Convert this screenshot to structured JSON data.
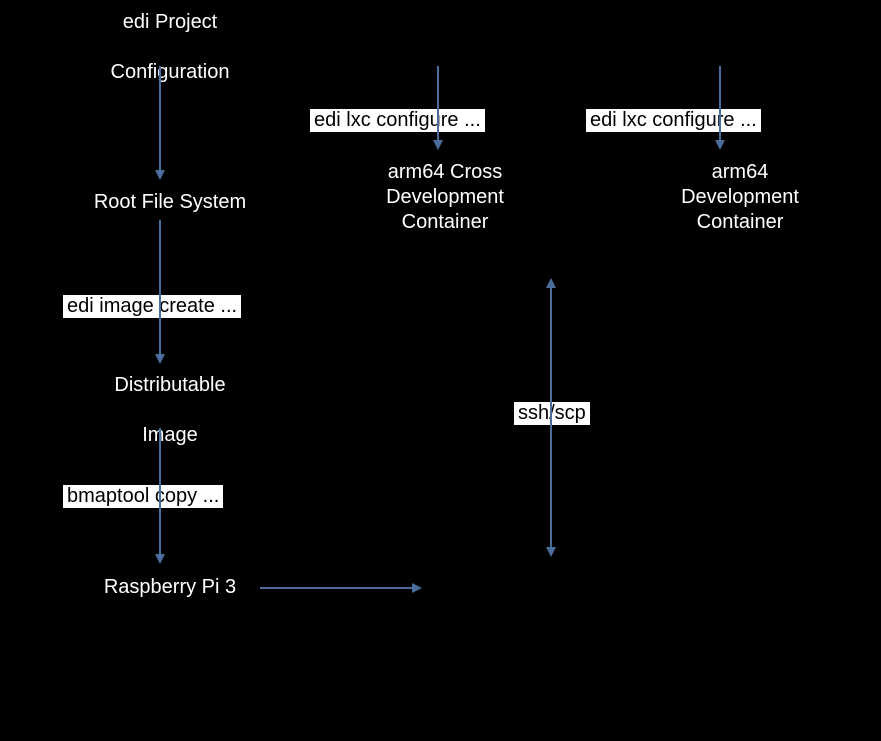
{
  "nodes": {
    "project_config": "edi Project\nConfiguration",
    "root_fs": "Root File System",
    "distributable": "Distributable\nImage",
    "pi3": "Raspberry Pi 3",
    "cross_dev_line1": "arm64 Cross",
    "cross_dev_line2": "Development",
    "cross_dev_line3": "Container",
    "dev_line1": "arm64",
    "dev_line2": "Development",
    "dev_line3": "Container"
  },
  "labels": {
    "edi_lxc_configure_1": "edi lxc configure ...",
    "edi_lxc_configure_2": "edi lxc configure ...",
    "edi_image_create": "edi image create ...",
    "bmaptool_copy": "bmaptool copy ...",
    "ssh_scp": "ssh/scp"
  },
  "colors": {
    "arrow": "#4a6d9c"
  }
}
